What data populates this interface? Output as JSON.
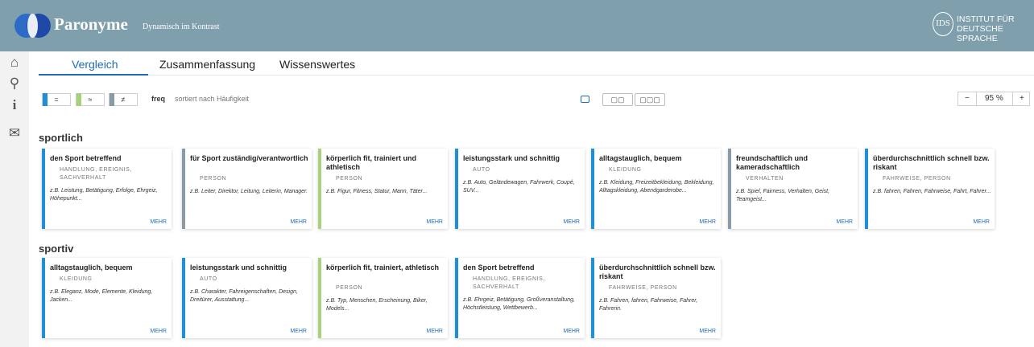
{
  "app": {
    "title": "Paronyme",
    "subtitle": "Dynamisch im Kontrast",
    "institute_line1": "INSTITUT FÜR",
    "institute_line2": "DEUTSCHE SPRACHE",
    "ids_mark": "IDS"
  },
  "sidebar": {
    "items": [
      {
        "icon": "home-icon",
        "glyph": "⌂"
      },
      {
        "icon": "search-icon",
        "glyph": "⚲"
      },
      {
        "icon": "info-icon",
        "glyph": "i"
      },
      {
        "icon": "mail-icon",
        "glyph": "✉"
      }
    ]
  },
  "tabs": [
    {
      "label": "Vergleich",
      "active": true
    },
    {
      "label": "Zusammenfassung",
      "active": false
    },
    {
      "label": "Wissenswertes",
      "active": false
    }
  ],
  "filters": {
    "btn1": "=",
    "btn2": "≈",
    "btn3": "≠",
    "freq": "freq",
    "sort_label": "sortiert nach Häufigkeit"
  },
  "layout_options": [
    "",
    "▢▢",
    "▢▢▢"
  ],
  "zoom": {
    "minus": "−",
    "value": "95 %",
    "plus": "+"
  },
  "colors": {
    "blue": "#1f8fd6",
    "green": "#a6d27b",
    "gray": "#8a9ba5",
    "header": "#7f9fad"
  },
  "sections": [
    {
      "title": "sportlich",
      "cards": [
        {
          "title": "den Sport betreffend",
          "category": "Handlung, Ereignis, Sachverhalt",
          "examples": "z.B. Leistung, Betätigung, Erfolge, Ehrgeiz, Höhepunkt...",
          "more": "MEHR",
          "color": "blue"
        },
        {
          "title": "für Sport zuständig/verantwortlich",
          "category": "Person",
          "examples": "z.B. Leiter, Direktor, Leitung, Leiterin, Manager.",
          "more": "MEHR",
          "color": "gray"
        },
        {
          "title": "körperlich fit, trainiert und athletisch",
          "category": "Person",
          "examples": "z.B. Figur, Fitness, Statur, Mann, Täter...",
          "more": "MEHR",
          "color": "green"
        },
        {
          "title": "leistungsstark und schnittig",
          "category": "Auto",
          "examples": "z.B. Auto, Geländewagen, Fahrwerk, Coupé, SUV...",
          "more": "MEHR",
          "color": "blue"
        },
        {
          "title": "alltagstauglich, bequem",
          "category": "Kleidung",
          "examples": "z.B. Kleidung, Freizeitbekleidung, Bekleidung, Alltagskleidung, Abendgarderobe...",
          "more": "MEHR",
          "color": "blue"
        },
        {
          "title": "freundschaftlich und kameradschaftlich",
          "category": "Verhalten",
          "examples": "z.B. Spiel, Fairness, Verhalten, Geist, Teamgeist...",
          "more": "MEHR",
          "color": "gray"
        },
        {
          "title": "überdurchschnittlich schnell bzw. riskant",
          "category": "Fahrweise, Person",
          "examples": "z.B. fahren, Fahren, Fahrweise, Fahrt, Fahrer...",
          "more": "MEHR",
          "color": "blue"
        }
      ]
    },
    {
      "title": "sportiv",
      "cards": [
        {
          "title": "alltagstauglich, bequem",
          "category": "Kleidung",
          "examples": "z.B. Eleganz, Mode, Elemente, Kleidung, Jacken...",
          "more": "MEHR",
          "color": "blue"
        },
        {
          "title": "leistungsstark und schnittig",
          "category": "Auto",
          "examples": "z.B. Charakter, Fahreigenschaften, Design, Dreitürer, Ausstattung...",
          "more": "MEHR",
          "color": "blue"
        },
        {
          "title": "körperlich fit, trainiert, athletisch",
          "category": "Person",
          "examples": "z.B. Typ, Menschen, Erscheinung, Biker, Models...",
          "more": "MEHR",
          "color": "green"
        },
        {
          "title": "den Sport betreffend",
          "category": "Handlung, Ereignis, Sachverhalt",
          "examples": "z.B. Ehrgeiz, Betätigung, Großveranstaltung, Höchstleistung, Wettbewerb...",
          "more": "MEHR",
          "color": "blue"
        },
        {
          "title": "überdurchschnittlich schnell bzw. riskant",
          "category": "Fahrweise, Person",
          "examples": "z.B. Fahren, fahren, Fahrweise, Fahrer, Fahrerin.",
          "more": "MEHR",
          "color": "blue"
        }
      ]
    }
  ]
}
